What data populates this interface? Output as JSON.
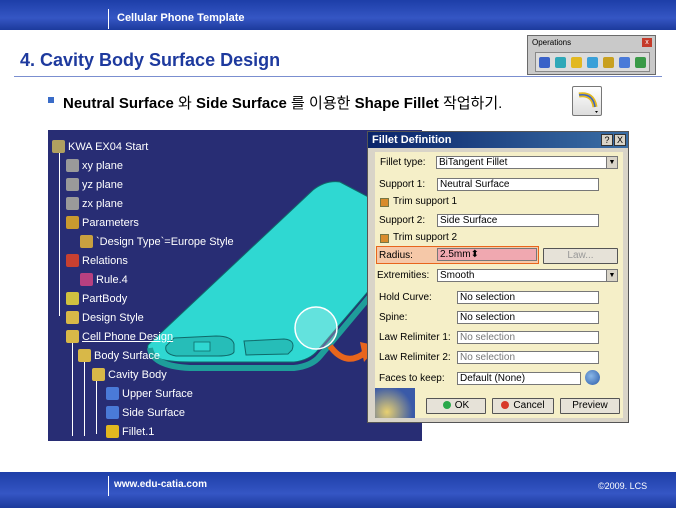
{
  "header": {
    "template_title": "Cellular Phone Template"
  },
  "slide": {
    "title": "4. Cavity Body Surface Design",
    "bullet_part1": "Neutral Surface",
    "bullet_part2": " 와 ",
    "bullet_part3": "Side Surface",
    "bullet_part4": " 를 이용한 ",
    "bullet_part5": "Shape Fillet",
    "bullet_part6": " 작업하기."
  },
  "operations_toolbar": {
    "title": "Operations",
    "close": "x",
    "icons": [
      "join-icon",
      "healing-icon",
      "fillet-icon",
      "split-icon",
      "trim-icon",
      "extrapolate-icon",
      "transform-icon"
    ]
  },
  "spec_tree": {
    "nodes": [
      {
        "label": "KWA EX04 Start",
        "icon": "product-icon"
      },
      {
        "label": "xy plane",
        "icon": "plane-icon"
      },
      {
        "label": "yz plane",
        "icon": "plane-icon"
      },
      {
        "label": "zx plane",
        "icon": "plane-icon"
      },
      {
        "label": "Parameters",
        "icon": "parameters-icon"
      },
      {
        "label": "`Design Type`=Europe Style",
        "icon": "parameter-icon"
      },
      {
        "label": "Relations",
        "icon": "relations-icon"
      },
      {
        "label": "Rule.4",
        "icon": "rule-icon"
      },
      {
        "label": "PartBody",
        "icon": "partbody-icon"
      },
      {
        "label": "Design Style",
        "icon": "geometrical-set-icon"
      },
      {
        "label": "Cell Phone Design",
        "icon": "geometrical-set-icon"
      },
      {
        "label": "Body Surface",
        "icon": "geometrical-set-icon"
      },
      {
        "label": "Cavity Body",
        "icon": "geometrical-set-icon"
      },
      {
        "label": "Upper Surface",
        "icon": "surface-icon"
      },
      {
        "label": "Side Surface",
        "icon": "surface-icon"
      },
      {
        "label": "Fillet.1",
        "icon": "fillet-icon"
      }
    ]
  },
  "dialog": {
    "title": "Fillet Definition",
    "help": "?",
    "close": "X",
    "fillet_type_label": "Fillet type:",
    "fillet_type_value": "BiTangent Fillet",
    "support1_label": "Support 1:",
    "support1_value": "Neutral Surface",
    "trim1_label": "Trim support 1",
    "support2_label": "Support 2:",
    "support2_value": "Side Surface",
    "trim2_label": "Trim support 2",
    "radius_label": "Radius:",
    "radius_value": "2.5mm",
    "law_label": "Law...",
    "extremities_label": "Extremities:",
    "extremities_value": "Smooth",
    "hold_curve_label": "Hold Curve:",
    "hold_curve_value": "No selection",
    "spine_label": "Spine:",
    "spine_value": "No selection",
    "relimiter1_label": "Law Relimiter 1:",
    "relimiter1_value": "No selection",
    "relimiter2_label": "Law Relimiter 2:",
    "relimiter2_value": "No selection",
    "faces_label": "Faces to keep:",
    "faces_value": "Default (None)",
    "ok_label": "OK",
    "cancel_label": "Cancel",
    "preview_label": "Preview"
  },
  "footer": {
    "url": "www.edu-catia.com",
    "copyright": "©2009. LCS"
  },
  "colors": {
    "bar": "#2746b4",
    "title": "#1e3a9e",
    "viewport": "#282d74",
    "surface": "#2fd8d2",
    "arrow": "#e8651c",
    "dialog_body": "#f5efc8"
  }
}
